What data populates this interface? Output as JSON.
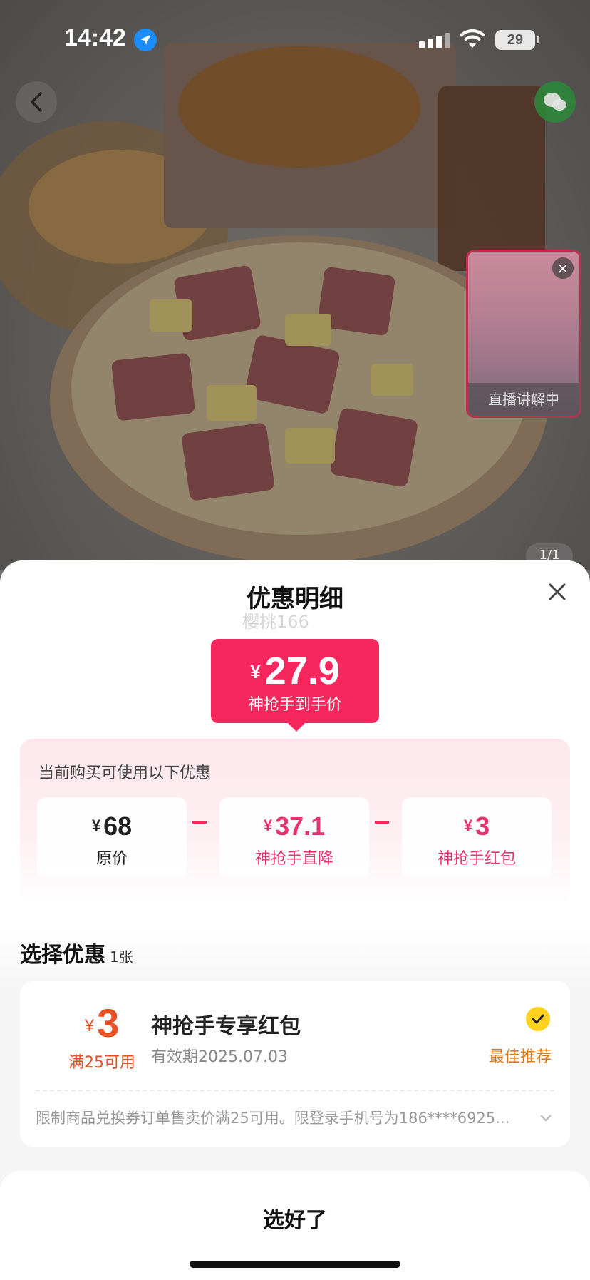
{
  "status_bar": {
    "time": "14:42",
    "battery": "29"
  },
  "live_preview": {
    "label": "直播讲解中"
  },
  "gallery": {
    "page_indicator": "1/1"
  },
  "sheet": {
    "title": "优惠明细",
    "ghost_text": "樱桃166",
    "final_price": {
      "currency": "¥",
      "value": "27.9",
      "label": "神抢手到手价"
    },
    "breakdown": {
      "title": "当前购买可使用以下优惠",
      "items": [
        {
          "currency": "¥",
          "value": "68",
          "label": "原价"
        },
        {
          "currency": "¥",
          "value": "37.1",
          "label": "神抢手直降"
        },
        {
          "currency": "¥",
          "value": "3",
          "label": "神抢手红包"
        }
      ],
      "operator": "-"
    },
    "select": {
      "title": "选择优惠",
      "count": "1张"
    },
    "coupon": {
      "currency": "¥",
      "amount": "3",
      "condition": "满25可用",
      "name": "神抢手专享红包",
      "validity": "有效期2025.07.03",
      "badge": "最佳推荐",
      "description": "限制商品兑换券订单售卖价满25可用。限登录手机号为186****6925..."
    },
    "confirm_label": "选好了"
  },
  "colors": {
    "accent": "#f5275c",
    "coupon": "#e84f24",
    "best": "#e07a12",
    "check": "#ffd21f"
  }
}
